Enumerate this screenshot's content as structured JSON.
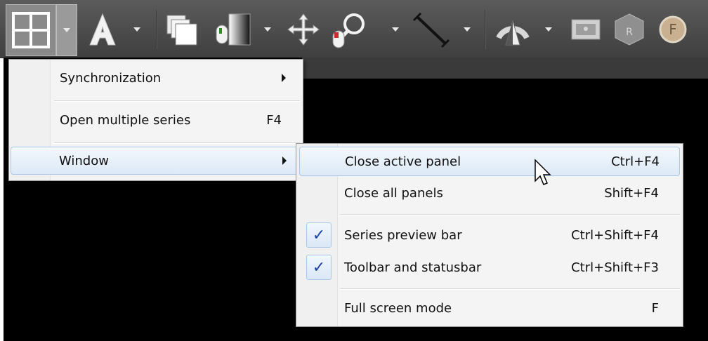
{
  "toolbar": {
    "buttons": [
      {
        "name": "layout-grid",
        "icon": "grid-icon",
        "has_dropdown": true
      },
      {
        "name": "annotation",
        "icon": "letter-a-icon",
        "has_dropdown": true
      },
      {
        "name": "series",
        "icon": "stacked-images-icon",
        "has_dropdown": false
      },
      {
        "name": "window-level",
        "icon": "mouse-contrast-icon",
        "has_dropdown": true
      },
      {
        "name": "pan",
        "icon": "move-arrows-icon",
        "has_dropdown": false
      },
      {
        "name": "zoom",
        "icon": "magnifier-mouse-icon",
        "has_dropdown": true
      },
      {
        "name": "measure",
        "icon": "line-measure-icon",
        "has_dropdown": true
      },
      {
        "name": "3d-view",
        "icon": "3d-volume-icon",
        "has_dropdown": true
      },
      {
        "name": "cine",
        "icon": "film-icon",
        "has_dropdown": false
      },
      {
        "name": "mpr",
        "icon": "mpr-icon",
        "has_dropdown": false
      },
      {
        "name": "fusion",
        "icon": "fusion-f-icon",
        "has_dropdown": false
      }
    ]
  },
  "layout_menu": {
    "items": [
      {
        "label": "Synchronization",
        "shortcut": "",
        "submenu": true
      },
      {
        "label": "Open multiple series",
        "shortcut": "F4",
        "submenu": false
      },
      {
        "label": "Window",
        "shortcut": "",
        "submenu": true
      }
    ]
  },
  "window_submenu": {
    "items": [
      {
        "label": "Close active panel",
        "shortcut": "Ctrl+F4",
        "checked": false
      },
      {
        "label": "Close all panels",
        "shortcut": "Shift+F4",
        "checked": false
      },
      {
        "label": "Series preview bar",
        "shortcut": "Ctrl+Shift+F4",
        "checked": true
      },
      {
        "label": "Toolbar and statusbar",
        "shortcut": "Ctrl+Shift+F3",
        "checked": true
      },
      {
        "label": "Full screen mode",
        "shortcut": "F",
        "checked": false
      }
    ],
    "check_glyph": "✓"
  },
  "colors": {
    "toolbar_bg": "#4a4a4a",
    "highlight_border": "#a8c8ea",
    "check_color": "#1d3fa8"
  }
}
